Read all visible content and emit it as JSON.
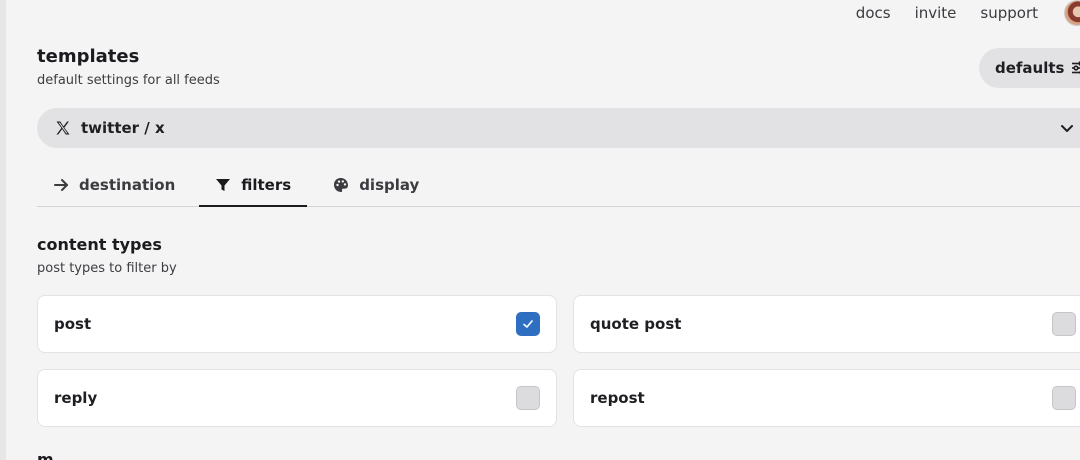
{
  "nav": {
    "links": [
      "docs",
      "invite",
      "support"
    ]
  },
  "header": {
    "title": "templates",
    "subtitle": "default settings for all feeds",
    "defaults_button": "defaults"
  },
  "platform": {
    "selected": "twitter / x"
  },
  "tabs": [
    {
      "label": "destination",
      "icon": "arrow-right-icon",
      "active": false
    },
    {
      "label": "filters",
      "icon": "filter-icon",
      "active": true
    },
    {
      "label": "display",
      "icon": "palette-icon",
      "active": false
    }
  ],
  "content_types": {
    "title": "content types",
    "subtitle": "post types to filter by",
    "items": [
      {
        "label": "post",
        "checked": true
      },
      {
        "label": "quote post",
        "checked": false
      },
      {
        "label": "reply",
        "checked": false
      },
      {
        "label": "repost",
        "checked": false
      }
    ]
  },
  "next_section": {
    "title": "m"
  },
  "colors": {
    "accent": "#2f6fc1",
    "background": "#f4f4f4",
    "pill": "#e2e2e4"
  }
}
